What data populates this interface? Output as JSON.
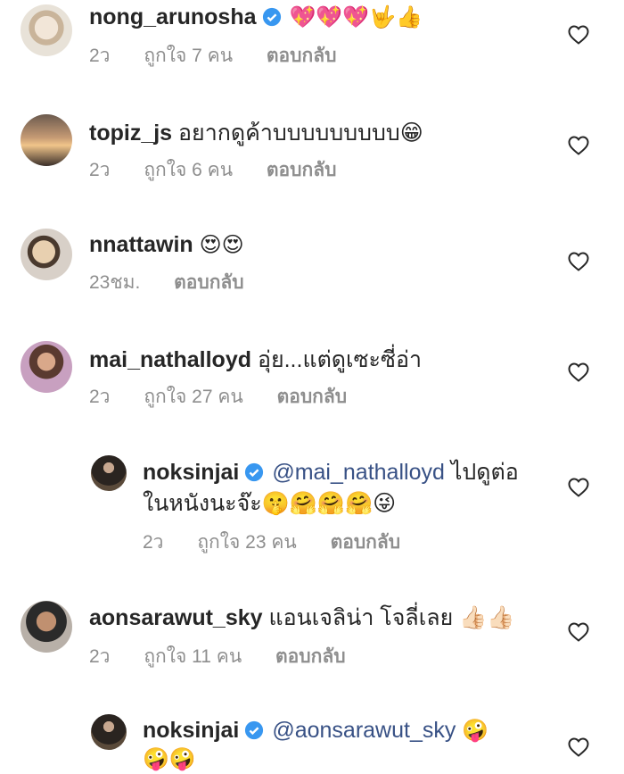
{
  "comments": [
    {
      "username": "nong_arunosha",
      "verified": true,
      "text": "💖💖💖🤟👍",
      "time": "2ว",
      "likes": "ถูกใจ 7 คน",
      "reply": "ตอบกลับ"
    },
    {
      "username": "topiz_js",
      "verified": false,
      "text": "อยากดูค้าบบบบบบบบบ😁",
      "time": "2ว",
      "likes": "ถูกใจ 6 คน",
      "reply": "ตอบกลับ"
    },
    {
      "username": "nnattawin",
      "verified": false,
      "text": "😍😍",
      "time": "23ชม.",
      "reply": "ตอบกลับ"
    },
    {
      "username": "mai_nathalloyd",
      "verified": false,
      "text": "อุ่ย...แต่ดูเซะซี่อ่า",
      "time": "2ว",
      "likes": "ถูกใจ 27 คน",
      "reply": "ตอบกลับ"
    },
    {
      "username": "noksinjai",
      "verified": true,
      "mention": "@mai_nathalloyd",
      "text": "ไปดูต่อ",
      "text2": "ในหนังนะจ๊ะ🤫🤗🤗🤗😜",
      "time": "2ว",
      "likes": "ถูกใจ 23 คน",
      "reply": "ตอบกลับ"
    },
    {
      "username": "aonsarawut_sky",
      "verified": false,
      "text": "แอนเจลิน่า โจลี่เลย 👍🏻👍🏻",
      "time": "2ว",
      "likes": "ถูกใจ 11 คน",
      "reply": "ตอบกลับ"
    },
    {
      "username": "noksinjai",
      "verified": true,
      "mention": "@aonsarawut_sky",
      "text": "🤪",
      "text2": "🤪🤪"
    }
  ],
  "colors": {
    "username": "#262626",
    "mention": "#385185",
    "meta": "#8e8e8e",
    "verified": "#3897f0"
  }
}
